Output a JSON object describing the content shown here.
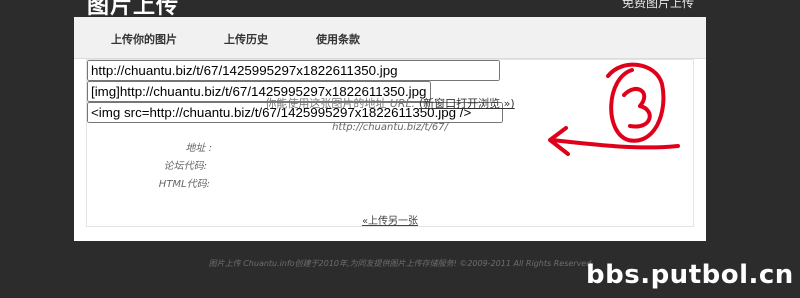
{
  "header": {
    "site_title": "图片上传",
    "top_right_link": "免费图片上传"
  },
  "nav": {
    "items": [
      {
        "label": "上传你的图片"
      },
      {
        "label": "上传历史"
      },
      {
        "label": "使用条款"
      }
    ]
  },
  "result": {
    "intro_text": "你能使用这张图片的地址",
    "url_label": "URL:",
    "open_link": "(新窗口打开浏览 »)",
    "short_url": "http://chuantu.biz/t/67/",
    "fields": [
      {
        "label": "地址 :",
        "value": "http://chuantu.biz/t/67/1425995297x1822611350.jpg"
      },
      {
        "label": "论坛代码:",
        "value": "[img]http://chuantu.biz/t/67/1425995297x1822611350.jpg[/img]"
      },
      {
        "label": "HTML代码:",
        "value": "<img src=http://chuantu.biz/t/67/1425995297x1822611350.jpg />"
      }
    ],
    "upload_another": "«上传另一张"
  },
  "footer": {
    "text": "图片上传 Chuantu.info创建于2010年,为同友提供图片上传存储服务! ©2009-2011 All Rights Reserved"
  },
  "annotation": {
    "number": "3",
    "color": "#e0001a"
  },
  "watermark": {
    "text": "bbs.putbol.cn"
  },
  "colors": {
    "page_bg": "#2c2c2c",
    "panel_bg": "#ffffff",
    "nav_bg": "#f1f1f1"
  }
}
